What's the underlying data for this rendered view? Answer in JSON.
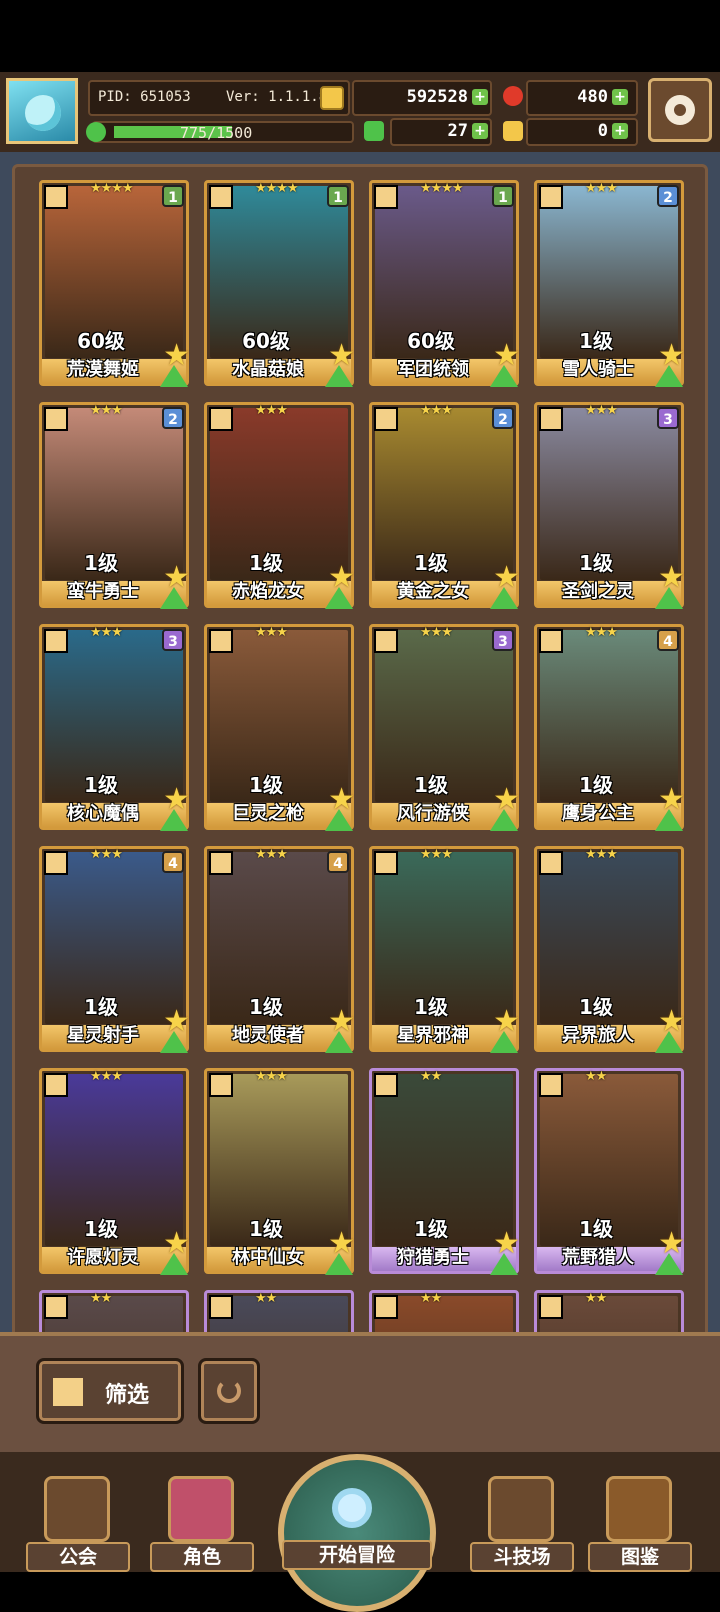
{
  "header": {
    "pid": "PID: 651053",
    "version": "Ver: 1.1.1.8",
    "gold": "592528",
    "gems": "480",
    "exp": "775/1500",
    "exp_fraction": 0.517,
    "clover": "27",
    "scroll": "0"
  },
  "filter": {
    "label": "筛选"
  },
  "cards": [
    {
      "name": "荒漠舞姬",
      "level": "60级",
      "stars": "★★★★",
      "rank": "1",
      "rank_color": "#6aa84f",
      "frame": "gold",
      "bg": "#b8653a"
    },
    {
      "name": "水晶菇娘",
      "level": "60级",
      "stars": "★★★★",
      "rank": "1",
      "rank_color": "#6aa84f",
      "frame": "gold",
      "bg": "#2f8a9a"
    },
    {
      "name": "军团统领",
      "level": "60级",
      "stars": "★★★★",
      "rank": "1",
      "rank_color": "#6aa84f",
      "frame": "gold",
      "bg": "#6a5a8a"
    },
    {
      "name": "雪人骑士",
      "level": "1级",
      "stars": "★★★",
      "rank": "2",
      "rank_color": "#5b8fd6",
      "frame": "gold",
      "bg": "#8ab6d0"
    },
    {
      "name": "蛮牛勇士",
      "level": "1级",
      "stars": "★★★",
      "rank": "2",
      "rank_color": "#5b8fd6",
      "frame": "gold",
      "bg": "#c48a78"
    },
    {
      "name": "赤焰龙女",
      "level": "1级",
      "stars": "★★★",
      "rank": "",
      "rank_color": "",
      "frame": "gold",
      "bg": "#8a3a2a"
    },
    {
      "name": "黄金之女",
      "level": "1级",
      "stars": "★★★",
      "rank": "2",
      "rank_color": "#5b8fd6",
      "frame": "gold",
      "bg": "#a88a30"
    },
    {
      "name": "圣剑之灵",
      "level": "1级",
      "stars": "★★★",
      "rank": "3",
      "rank_color": "#9a6ad0",
      "frame": "gold",
      "bg": "#8a8aa0"
    },
    {
      "name": "核心魔偶",
      "level": "1级",
      "stars": "★★★",
      "rank": "3",
      "rank_color": "#9a6ad0",
      "frame": "gold",
      "bg": "#2a6a8a"
    },
    {
      "name": "巨灵之枪",
      "level": "1级",
      "stars": "★★★",
      "rank": "",
      "rank_color": "",
      "frame": "gold",
      "bg": "#8a5a3a"
    },
    {
      "name": "风行游侠",
      "level": "1级",
      "stars": "★★★",
      "rank": "3",
      "rank_color": "#9a6ad0",
      "frame": "gold",
      "bg": "#5a6a4a"
    },
    {
      "name": "鹰身公主",
      "level": "1级",
      "stars": "★★★",
      "rank": "4",
      "rank_color": "#d6a04a",
      "frame": "gold",
      "bg": "#6a8a7a"
    },
    {
      "name": "星灵射手",
      "level": "1级",
      "stars": "★★★",
      "rank": "4",
      "rank_color": "#d6a04a",
      "frame": "gold",
      "bg": "#3a5a8a"
    },
    {
      "name": "地灵使者",
      "level": "1级",
      "stars": "★★★",
      "rank": "4",
      "rank_color": "#d6a04a",
      "frame": "gold",
      "bg": "#5a4a4a"
    },
    {
      "name": "星界邪神",
      "level": "1级",
      "stars": "★★★",
      "rank": "",
      "rank_color": "",
      "frame": "gold",
      "bg": "#3a6a5a"
    },
    {
      "name": "异界旅人",
      "level": "1级",
      "stars": "★★★",
      "rank": "",
      "rank_color": "",
      "frame": "gold",
      "bg": "#3a4a5a"
    },
    {
      "name": "许愿灯灵",
      "level": "1级",
      "stars": "★★★",
      "rank": "",
      "rank_color": "",
      "frame": "gold",
      "bg": "#4a3a9a"
    },
    {
      "name": "林中仙女",
      "level": "1级",
      "stars": "★★★",
      "rank": "",
      "rank_color": "",
      "frame": "gold",
      "bg": "#a89a5a"
    },
    {
      "name": "狩猎勇士",
      "level": "1级",
      "stars": "★★",
      "rank": "",
      "rank_color": "",
      "frame": "purple",
      "bg": "#3a4a3a"
    },
    {
      "name": "荒野猎人",
      "level": "1级",
      "stars": "★★",
      "rank": "",
      "rank_color": "",
      "frame": "purple",
      "bg": "#8a5a3a"
    }
  ],
  "partial_cards": [
    {
      "stars": "★★",
      "frame": "purple",
      "bg": "#5a4a4a"
    },
    {
      "stars": "★★",
      "frame": "purple",
      "bg": "#4a4a5a"
    },
    {
      "stars": "★★",
      "frame": "purple",
      "bg": "#8a4a2a"
    },
    {
      "stars": "★★",
      "frame": "purple",
      "bg": "#6a4a3a"
    }
  ],
  "nav": {
    "guild": "公会",
    "role": "角色",
    "start": "开始冒险",
    "arena": "斗技场",
    "codex": "图鉴"
  }
}
